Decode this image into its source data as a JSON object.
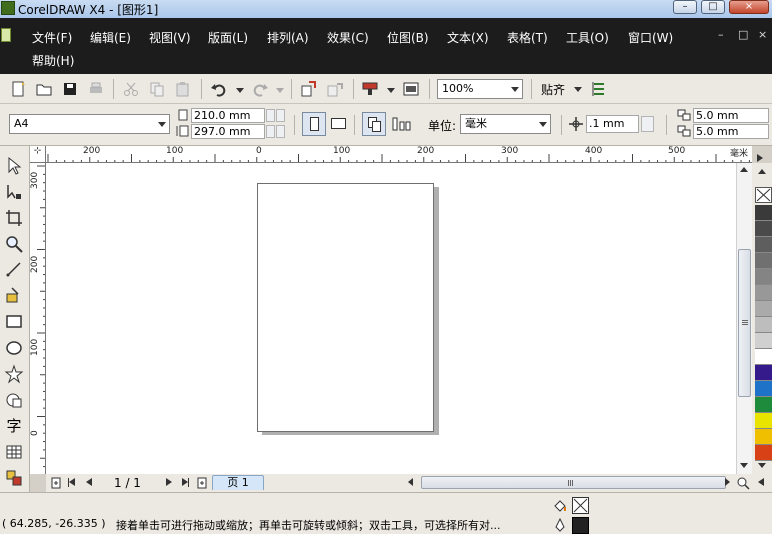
{
  "window": {
    "title": "CorelDRAW X4 - [图形1]",
    "min": "–",
    "max": "□",
    "close": "×"
  },
  "menu": {
    "items": [
      "文件(F)",
      "编辑(E)",
      "视图(V)",
      "版面(L)",
      "排列(A)",
      "效果(C)",
      "位图(B)",
      "文本(X)",
      "表格(T)",
      "工具(O)",
      "窗口(W)"
    ],
    "help": "帮助(H)"
  },
  "toolbar": {
    "zoom": "100%",
    "snap_label": "贴齐",
    "icons": [
      "new-file-icon",
      "open-folder-icon",
      "save-icon",
      "print-icon",
      "cut-icon",
      "copy-icon",
      "paste-icon",
      "undo-icon",
      "redo-icon",
      "import-icon",
      "export-icon",
      "application-launcher-icon",
      "welcome-screen-icon",
      "options-icon"
    ]
  },
  "property_bar": {
    "paper_size": "A4",
    "width": "210.0 mm",
    "height": "297.0 mm",
    "unit_label": "单位:",
    "unit": "毫米",
    "nudge": ".1 mm",
    "dup_x": "5.0 mm",
    "dup_y": "5.0 mm"
  },
  "rulers": {
    "h_labels": [
      "200",
      "100",
      "0",
      "100",
      "200",
      "300",
      "400",
      "500"
    ],
    "unit_label": "毫米",
    "v_labels": [
      "300",
      "200",
      "100",
      "0"
    ]
  },
  "toolbox": {
    "tools": [
      "pick-tool",
      "shape-tool",
      "crop-tool",
      "zoom-tool",
      "freehand-tool",
      "smart-fill-tool",
      "rectangle-tool",
      "ellipse-tool",
      "polygon-tool",
      "basic-shapes-tool",
      "text-tool",
      "table-tool",
      "interactive-blend-tool"
    ],
    "text_tool_glyph": "字"
  },
  "page_nav": {
    "current": "1 / 1",
    "tab": "页 1"
  },
  "palette": {
    "colors": [
      "#3a3a3a",
      "#4a4a4a",
      "#5e5e5e",
      "#707070",
      "#848484",
      "#989898",
      "#aaaaaa",
      "#bdbdbd",
      "#d0d0d0",
      "#ffffff",
      "#351a8c",
      "#1e73c8",
      "#1e8a3c",
      "#e8e400",
      "#f0c000",
      "#d84015"
    ]
  },
  "status": {
    "coords": "( 64.285, -26.335 )",
    "message": "接着单击可进行拖动或缩放；再单击可旋转或倾斜；双击工具，可选择所有对..."
  }
}
